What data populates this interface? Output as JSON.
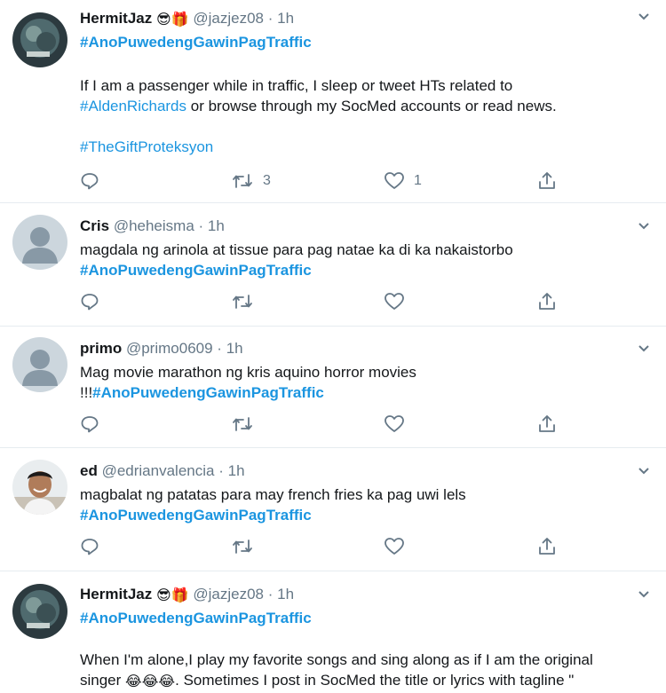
{
  "tweets": [
    {
      "name": "HermitJaz",
      "emojis": "😎🎁",
      "handle": "@jazjez08",
      "time": "1h",
      "hashtag": "#AnoPuwedengGawinPagTraffic",
      "body_before": "If I am a passenger while in traffic, I sleep or tweet HTs related to",
      "mention_tag": "#AldenRichards",
      "body_after": " or browse through my SocMed accounts or read news.",
      "extra_tag": "#TheGiftProteksyon",
      "retweets": "3",
      "likes": "1",
      "avatar": "dark-photo-avatar"
    },
    {
      "name": "Cris",
      "handle": "@heheisma",
      "time": "1h",
      "body": "magdala ng arinola at tissue para pag natae ka di ka nakaistorbo",
      "hashtag": "#AnoPuwedengGawinPagTraffic",
      "avatar": "default-avatar"
    },
    {
      "name": "primo",
      "handle": "@primo0609",
      "time": "1h",
      "body": "Mag movie marathon ng kris aquino horror movies",
      "prefix": "!!!",
      "hashtag": "#AnoPuwedengGawinPagTraffic",
      "avatar": "default-avatar"
    },
    {
      "name": "ed",
      "handle": "@edrianvalencia",
      "time": "1h",
      "body": "magbalat ng patatas para may french fries ka pag uwi lels",
      "hashtag": "#AnoPuwedengGawinPagTraffic",
      "avatar": "person-photo-avatar"
    },
    {
      "name": "HermitJaz",
      "emojis": "😎🎁",
      "handle": "@jazjez08",
      "time": "1h",
      "hashtag": "#AnoPuwedengGawinPagTraffic",
      "body_line1": "When I'm alone,I play my favorite songs and sing along as if I am the original",
      "body_line2_a": "singer ",
      "laugh_emojis": "😂😂😂",
      "body_line2_b": ". Sometimes I post in SocMed the title or lyrics with tagline \"",
      "avatar": "dark-photo-avatar"
    }
  ],
  "separator": "·",
  "icons": {
    "reply": "reply-icon",
    "retweet": "retweet-icon",
    "like": "like-icon",
    "share": "share-icon",
    "caret": "chevron-down-icon"
  },
  "colors": {
    "accent": "#1b95e0",
    "secondary": "#657786",
    "border": "#e6ecf0"
  }
}
